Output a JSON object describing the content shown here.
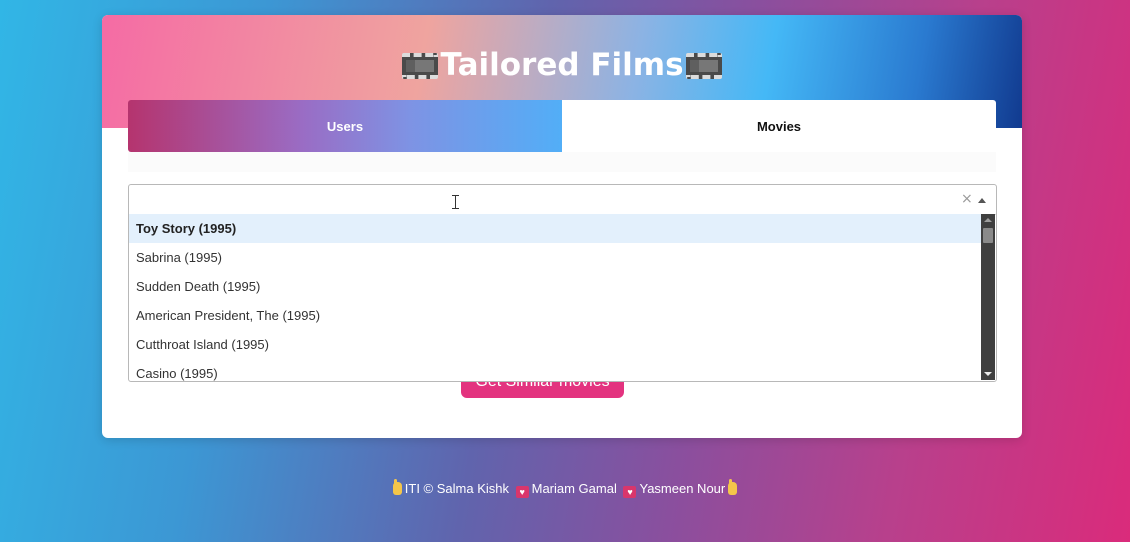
{
  "app": {
    "title": "Tailored Films",
    "title_icon": "film-frames-icon"
  },
  "tabs": [
    {
      "label": "Users"
    },
    {
      "label": "Movies"
    }
  ],
  "movie_select": {
    "value": "",
    "clear_glyph": "×",
    "options": [
      {
        "label": "Toy Story (1995)"
      },
      {
        "label": "Sabrina (1995)"
      },
      {
        "label": "Sudden Death (1995)"
      },
      {
        "label": "American President, The (1995)"
      },
      {
        "label": "Cutthroat Island (1995)"
      },
      {
        "label": "Casino (1995)"
      }
    ]
  },
  "actions": {
    "similar_label": "Get Similar movies"
  },
  "footer": {
    "org": "ITI © Salma Kishk",
    "name2": "Mariam Gamal",
    "name3": "Yasmeen Nour"
  },
  "colors": {
    "accent_pink": "#e3337f",
    "active_option_bg": "#e3f0fc"
  }
}
